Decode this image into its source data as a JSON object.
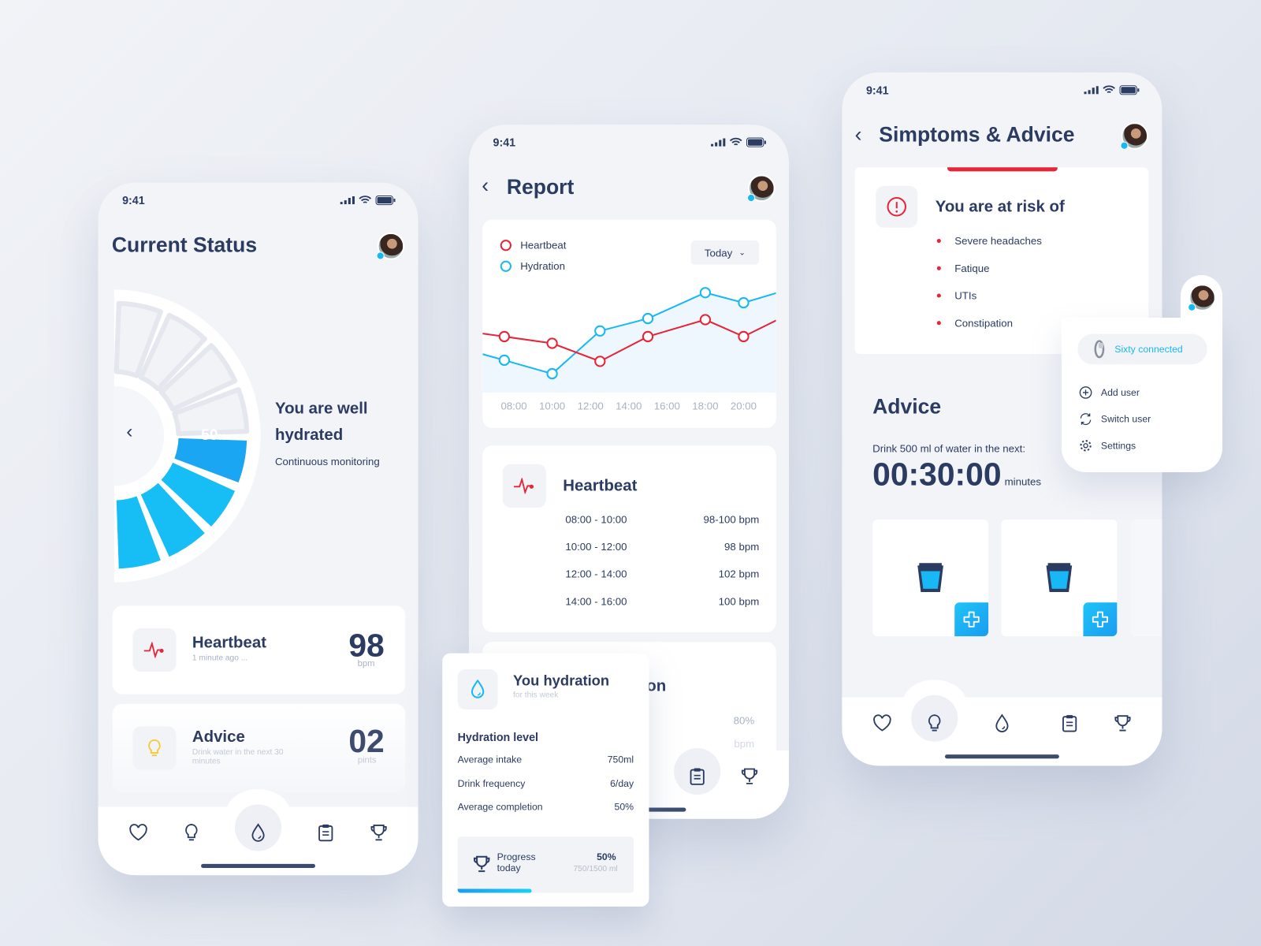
{
  "colors": {
    "navy": "#2b3b61",
    "accent": "#17b8f5",
    "heartbeat": "#e52538",
    "muted": "#a9b1c3",
    "bulb": "#f7c92f"
  },
  "status_time": "9:41",
  "current_status": {
    "title": "Current Status",
    "gauge": {
      "percent": 50,
      "label": "50",
      "unit": "%"
    },
    "message_line1": "You are well",
    "message_line2": "hydrated",
    "message_sub": "Continuous monitoring",
    "heartbeat": {
      "title": "Heartbeat",
      "subtitle": "1 minute ago ...",
      "value": "98",
      "unit": "bpm"
    },
    "advice": {
      "title": "Advice",
      "subtitle": "Drink water in the next 30 minutes",
      "value": "02",
      "unit": "pints"
    },
    "nav": [
      "heart-icon",
      "bulb-icon",
      "drop-icon",
      "clipboard-icon",
      "trophy-icon"
    ],
    "nav_active": "drop-icon"
  },
  "report": {
    "title": "Report",
    "filter": "Today",
    "chart_data": {
      "type": "line",
      "series": [
        {
          "name": "Heartbeat",
          "color": "#e52538",
          "x": [
            "07:30",
            "10:00",
            "12:30",
            "15:00",
            "18:00",
            "20:00"
          ],
          "values": [
            44,
            38,
            22,
            44,
            59,
            44
          ]
        },
        {
          "name": "Hydration",
          "color": "#17b8f5",
          "x": [
            "07:30",
            "10:00",
            "12:30",
            "15:00",
            "18:00",
            "20:00"
          ],
          "values": [
            23,
            11,
            49,
            60,
            83,
            74
          ]
        }
      ],
      "xticks": [
        "08:00",
        "10:00",
        "12:00",
        "14:00",
        "16:00",
        "18:00",
        "20:00"
      ],
      "legend": "top-left",
      "grid": false
    },
    "heartbeat": {
      "title": "Heartbeat",
      "rows": [
        {
          "range": "08:00 - 10:00",
          "value": "98-100 bpm"
        },
        {
          "range": "10:00 - 12:00",
          "value": "98 bpm"
        },
        {
          "range": "12:00 - 14:00",
          "value": "102 bpm"
        },
        {
          "range": "14:00 - 16:00",
          "value": "100 bpm"
        }
      ]
    },
    "hydration_card": {
      "title": "Hydration",
      "value": "80%",
      "unit": "bpm"
    },
    "nav_active": "clipboard-icon"
  },
  "hydration_popup": {
    "title": "You hydration",
    "subtitle": "for this week",
    "section": "Hydration level",
    "rows": [
      {
        "label": "Average intake",
        "value": "750ml"
      },
      {
        "label": "Drink frequency",
        "value": "6/day"
      },
      {
        "label": "Average completion",
        "value": "50%"
      }
    ],
    "progress": {
      "label_line1": "Progress",
      "label_line2": "today",
      "percent_label": "50%",
      "detail": "750/1500 ml",
      "fraction": 0.5
    }
  },
  "symptoms": {
    "title": "Simptoms & Advice",
    "risk_title": "You are at risk of",
    "risks": [
      "Severe headaches",
      "Fatique",
      "UTIs",
      "Constipation"
    ],
    "advice_title": "Advice",
    "advice_text": "Drink 500 ml of water in the next:",
    "timer": "00:30:00",
    "timer_unit": "minutes",
    "nav_active": "bulb-icon"
  },
  "user_menu": {
    "device": "Sixty connected",
    "items": [
      "Add user",
      "Switch user",
      "Settings"
    ]
  }
}
